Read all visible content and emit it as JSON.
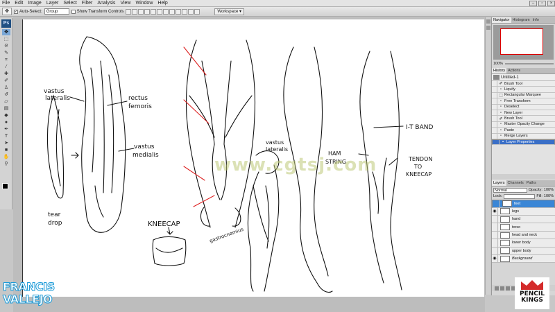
{
  "menubar": {
    "items": [
      "File",
      "Edit",
      "Image",
      "Layer",
      "Select",
      "Filter",
      "Analysis",
      "View",
      "Window",
      "Help"
    ]
  },
  "options_bar": {
    "auto_select_label": "Auto-Select:",
    "auto_select_value": "Group",
    "show_transform_label": "Show Transform Controls",
    "workspace_label": "Workspace ▾"
  },
  "toolbox": {
    "logo": "Ps",
    "tools": [
      "move-tool",
      "marquee-tool",
      "lasso-tool",
      "quick-select-tool",
      "crop-tool",
      "eyedropper-tool",
      "healing-tool",
      "brush-tool",
      "clone-stamp-tool",
      "history-brush-tool",
      "eraser-tool",
      "gradient-tool",
      "blur-tool",
      "dodge-tool",
      "pen-tool",
      "type-tool",
      "path-select-tool",
      "shape-tool",
      "hand-tool",
      "zoom-tool"
    ],
    "fg_color": "#000000",
    "bg_color": "#ffffff"
  },
  "navigator_panel": {
    "tabs": [
      "Navigator",
      "Histogram",
      "Info"
    ],
    "zoom": "100%"
  },
  "history_panel": {
    "tabs": [
      "History",
      "Actions"
    ],
    "document": "Untitled-1",
    "items": [
      "Brush Tool",
      "Liquify",
      "Rectangular Marquee",
      "Free Transform",
      "Deselect",
      "New Layer",
      "Brush Tool",
      "Master Opacity Change",
      "Paste",
      "Merge Layers",
      "Layer Properties"
    ],
    "selected_index": 10
  },
  "layers_panel": {
    "tabs": [
      "Layers",
      "Channels",
      "Paths"
    ],
    "blend_mode": "Normal",
    "opacity_label": "Opacity:",
    "opacity_value": "100%",
    "lock_label": "Lock:",
    "fill_label": "Fill:",
    "fill_value": "100%",
    "layers": [
      {
        "name": "feet",
        "visible": false,
        "selected": true
      },
      {
        "name": "legs",
        "visible": true,
        "selected": false
      },
      {
        "name": "hand",
        "visible": false,
        "selected": false
      },
      {
        "name": "torso",
        "visible": false,
        "selected": false
      },
      {
        "name": "head and neck",
        "visible": false,
        "selected": false
      },
      {
        "name": "lower body",
        "visible": false,
        "selected": false
      },
      {
        "name": "upper body",
        "visible": false,
        "selected": false
      },
      {
        "name": "Background",
        "visible": true,
        "selected": false
      }
    ]
  },
  "canvas": {
    "labels": {
      "vastus_lateralis_1": "vastus",
      "vastus_lateralis_2": "lateralis",
      "rectus_1": "rectus",
      "rectus_2": "femoris",
      "vastus_medialis_1": "vastus",
      "vastus_medialis_2": "medialis",
      "tear_drop_1": "tear",
      "tear_drop_2": "drop",
      "kneecap": "KNEECAP",
      "gastrocnemius": "gastrocnemius",
      "vastus_lat_b_1": "vastus",
      "vastus_lat_b_2": "lateralis",
      "it_band": "I-T BAND",
      "ham_string_1": "HAM",
      "ham_string_2": "STRING",
      "tendon_1": "TENDON",
      "tendon_2": "TO",
      "tendon_3": "KNEECAP"
    },
    "watermark": "www.cgtsj.com"
  },
  "branding": {
    "left_line1": "FRANCIS",
    "left_line2": "VALLEJO",
    "right_line1": "PENCIL",
    "right_line2": "KINGS",
    "left_color": "#1d9bd8",
    "right_color": "#d42b2b"
  }
}
